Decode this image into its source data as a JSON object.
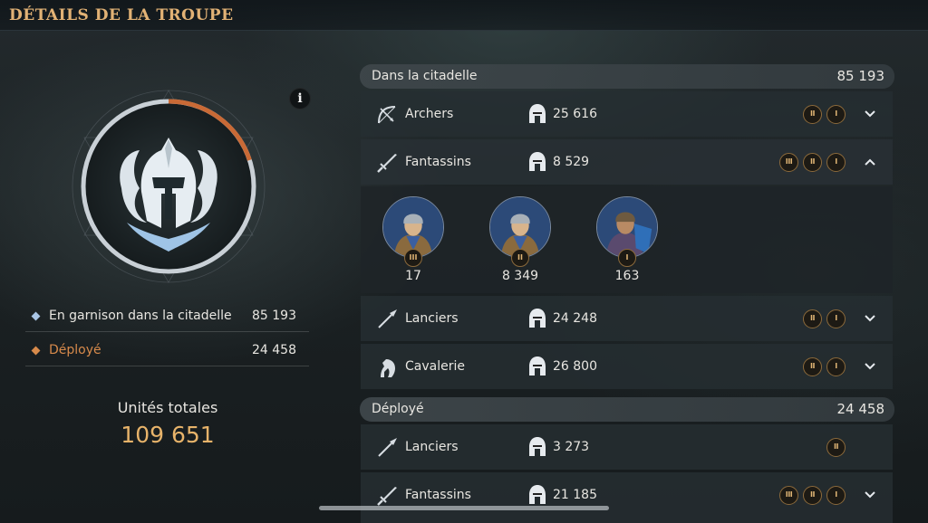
{
  "header": {
    "title": "DÉTAILS DE LA TROUPE"
  },
  "info": {
    "icon": "info-icon",
    "glyph": "i"
  },
  "emblem": {
    "icon": "helmet-emblem-icon",
    "ring_fill_percent": 20,
    "ring_color": "#c96a36"
  },
  "summary": {
    "rows": [
      {
        "label": "En garnison dans la citadelle",
        "value": "85 193",
        "color": "#a9c6e6"
      },
      {
        "label": "Déployé",
        "value": "24 458",
        "color": "#d78a4b"
      }
    ],
    "total_label": "Unités totales",
    "total_value": "109 651"
  },
  "sections": [
    {
      "label": "Dans la citadelle",
      "value": "85 193",
      "troops": [
        {
          "name": "Archers",
          "icon": "bow-icon",
          "count": "25 616",
          "tiers": [
            "II",
            "I"
          ],
          "expanded": false
        },
        {
          "name": "Fantassins",
          "icon": "sword-icon",
          "count": "8 529",
          "tiers": [
            "III",
            "II",
            "I"
          ],
          "expanded": true,
          "soldiers": [
            {
              "tier": "III",
              "count": "17"
            },
            {
              "tier": "II",
              "count": "8 349"
            },
            {
              "tier": "I",
              "count": "163"
            }
          ]
        },
        {
          "name": "Lanciers",
          "icon": "spear-icon",
          "count": "24 248",
          "tiers": [
            "II",
            "I"
          ],
          "expanded": false
        },
        {
          "name": "Cavalerie",
          "icon": "horse-icon",
          "count": "26 800",
          "tiers": [
            "II",
            "I"
          ],
          "expanded": false
        }
      ]
    },
    {
      "label": "Déployé",
      "value": "24 458",
      "troops": [
        {
          "name": "Lanciers",
          "icon": "spear-icon",
          "count": "3 273",
          "tiers": [
            "II"
          ],
          "expanded": null
        },
        {
          "name": "Fantassins",
          "icon": "sword-icon",
          "count": "21 185",
          "tiers": [
            "III",
            "II",
            "I"
          ],
          "expanded": false
        }
      ]
    }
  ],
  "colors": {
    "accent": "#e2b275",
    "total": "#e7b36a",
    "tier_border": "#8c6a3b"
  }
}
